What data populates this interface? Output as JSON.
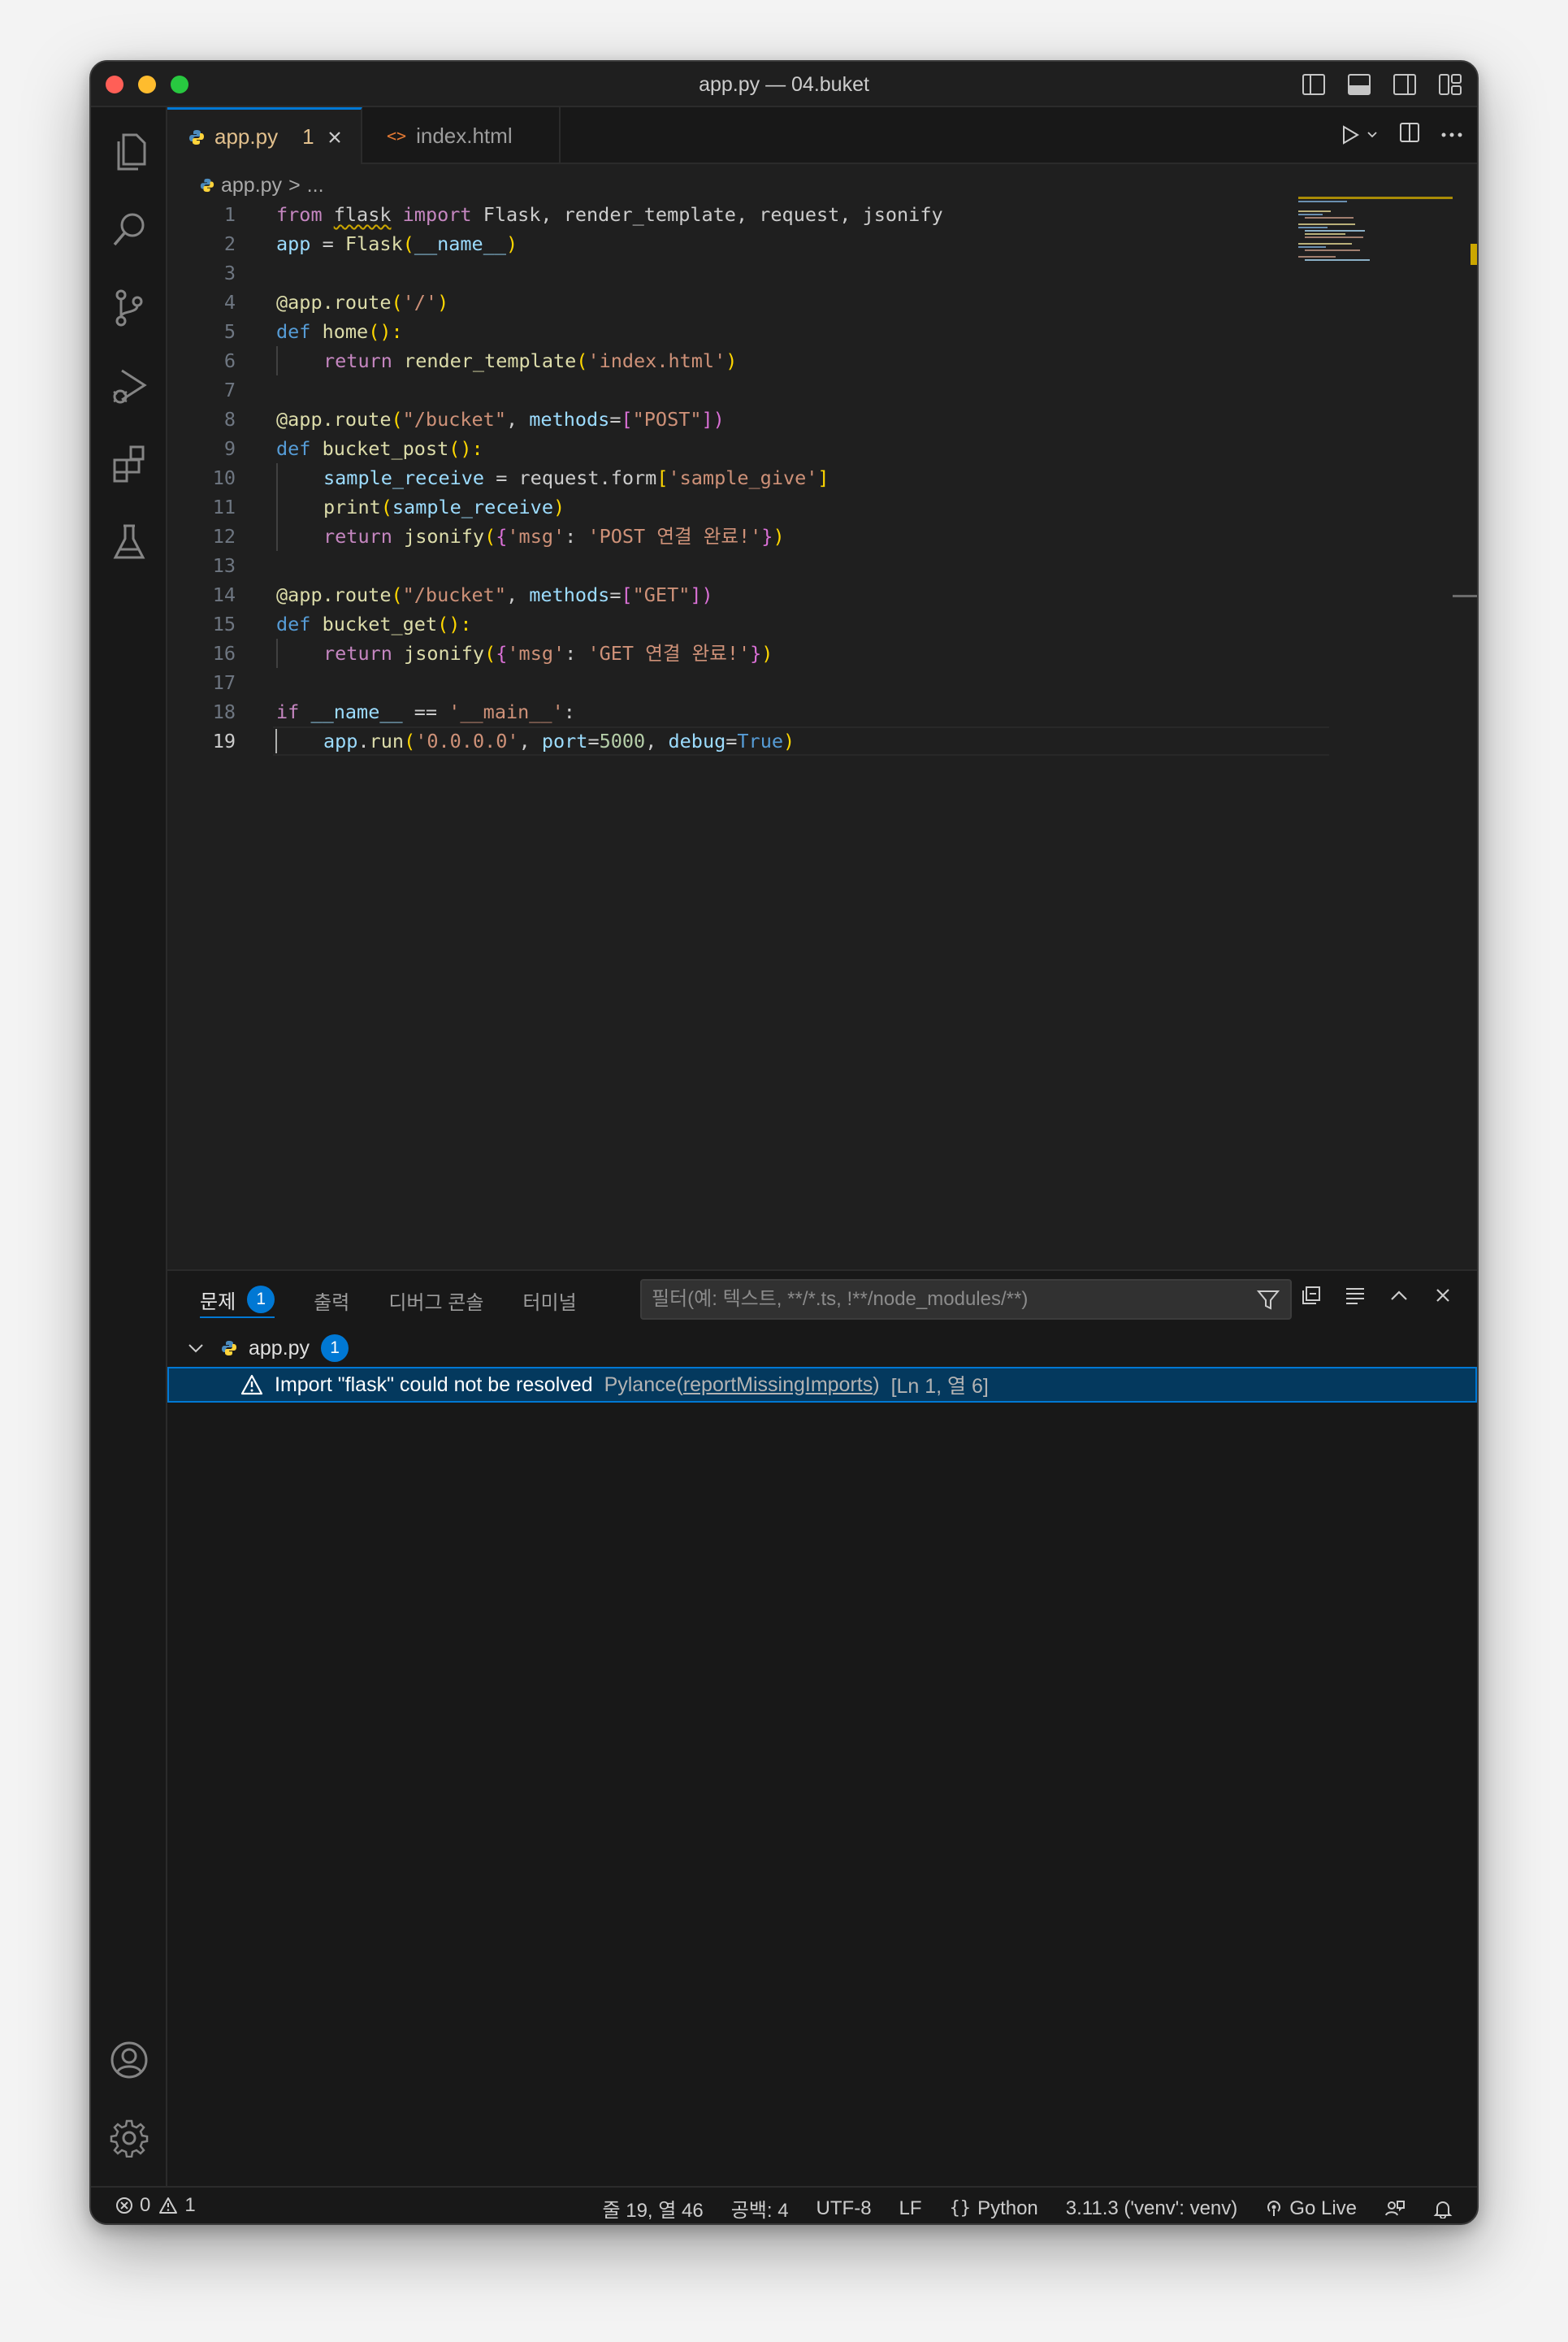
{
  "window": {
    "title": "app.py — 04.buket"
  },
  "tabs": [
    {
      "label": "app.py",
      "badge": "1",
      "active": true
    },
    {
      "label": "index.html",
      "active": false
    }
  ],
  "breadcrumb": {
    "file": "app.py",
    "separator": ">",
    "rest": "..."
  },
  "colors": {
    "accent": "#0078d4",
    "warning": "#cca700",
    "keyword": "#569cd6",
    "string": "#ce9178",
    "function": "#dcdcaa"
  },
  "editor": {
    "current_line": "19",
    "line_numbers": [
      "1",
      "2",
      "3",
      "4",
      "5",
      "6",
      "7",
      "8",
      "9",
      "10",
      "11",
      "12",
      "13",
      "14",
      "15",
      "16",
      "17",
      "18",
      "19"
    ],
    "tokens": {
      "l1": [
        "from",
        " ",
        "flask",
        " ",
        "import",
        " Flask, render_template, request, jsonify"
      ],
      "l2": [
        "app",
        " = ",
        "Flask",
        "(",
        "__name__",
        ")"
      ],
      "l4": [
        "@app.route",
        "(",
        "'/'",
        ")"
      ],
      "l5": [
        "def",
        " ",
        "home",
        "():"
      ],
      "l6": [
        "return",
        " ",
        "render_template",
        "(",
        "'index.html'",
        ")"
      ],
      "l8": [
        "@app.route",
        "(",
        "\"/bucket\"",
        ", ",
        "methods",
        "=",
        "[",
        "\"POST\"",
        "])"
      ],
      "l9": [
        "def",
        " ",
        "bucket_post",
        "():"
      ],
      "l10": [
        "sample_receive",
        " = ",
        "request",
        ".",
        "form",
        "[",
        "'sample_give'",
        "]"
      ],
      "l11": [
        "print",
        "(",
        "sample_receive",
        ")"
      ],
      "l12": [
        "return",
        " ",
        "jsonify",
        "(",
        "{",
        "'msg'",
        ": ",
        "'POST 연결 완료!'",
        "}",
        ")"
      ],
      "l14": [
        "@app.route",
        "(",
        "\"/bucket\"",
        ", ",
        "methods",
        "=",
        "[",
        "\"GET\"",
        "])"
      ],
      "l15": [
        "def",
        " ",
        "bucket_get",
        "():"
      ],
      "l16": [
        "return",
        " ",
        "jsonify",
        "(",
        "{",
        "'msg'",
        ": ",
        "'GET 연결 완료!'",
        "}",
        ")"
      ],
      "l18": [
        "if",
        " ",
        "__name__",
        " == ",
        "'__main__'",
        ":"
      ],
      "l19": [
        "app",
        ".",
        "run",
        "(",
        "'0.0.0.0'",
        ", ",
        "port",
        "=",
        "5000",
        ", ",
        "debug",
        "=",
        "True",
        ")"
      ]
    }
  },
  "panel": {
    "tabs": [
      {
        "label": "문제",
        "badge": "1",
        "active": true
      },
      {
        "label": "출력"
      },
      {
        "label": "디버그 콘솔"
      },
      {
        "label": "터미널"
      }
    ],
    "filter_placeholder": "필터(예: 텍스트, **/*.ts, !**/node_modules/**)",
    "problems": {
      "file": "app.py",
      "count": "1",
      "items": [
        {
          "message": "Import \"flask\" could not be resolved",
          "source_prefix": "Pylance(",
          "source_code": "reportMissingImports",
          "source_suffix": ")",
          "location": "[Ln 1, 열 6]"
        }
      ]
    }
  },
  "status": {
    "errors": "0",
    "warnings": "1",
    "position": "줄 19, 열 46",
    "spaces": "공백: 4",
    "encoding": "UTF-8",
    "eol": "LF",
    "language": "Python",
    "interpreter": "3.11.3 ('venv': venv)",
    "golive": "Go Live"
  }
}
